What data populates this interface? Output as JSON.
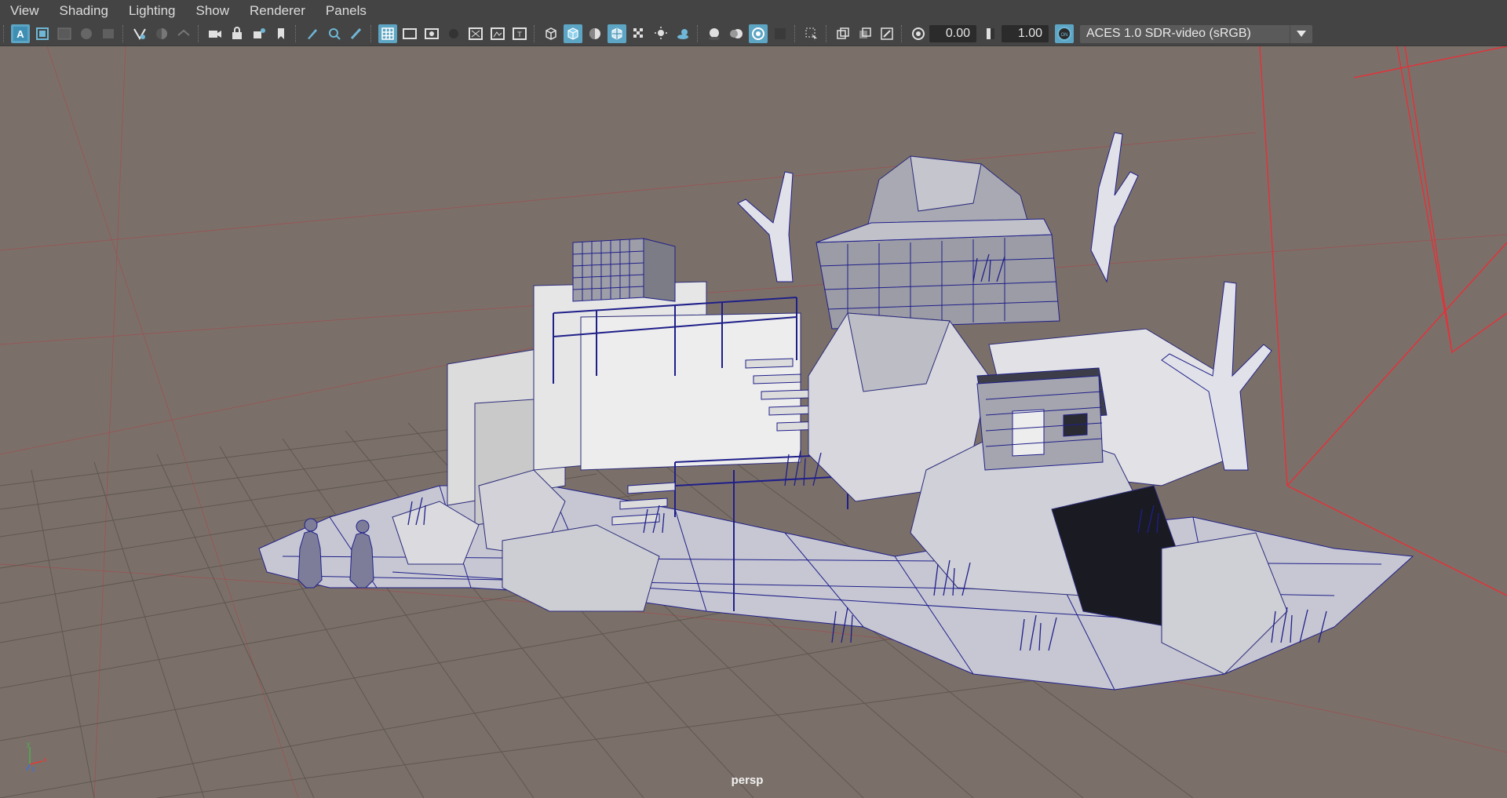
{
  "menubar": {
    "items": [
      "View",
      "Shading",
      "Lighting",
      "Show",
      "Renderer",
      "Panels"
    ]
  },
  "toolbar": {
    "exposure_value": "0.00",
    "gamma_value": "1.00",
    "color_management": "ACES 1.0 SDR-video (sRGB)",
    "accent_color": "#5da5c4",
    "icons": [
      "select-camera-icon",
      "camera-attributes-icon",
      "bookmark-icon",
      "image-plane-icon",
      "grid-icon",
      "film-gate-icon",
      "resolution-gate-icon",
      "gate-mask-icon",
      "field-chart-icon",
      "safe-action-icon",
      "safe-title-icon",
      "wireframe-icon",
      "smooth-shade-all-icon",
      "use-default-material-icon",
      "wireframe-on-shaded-icon",
      "xray-icon",
      "default-lighting-icon",
      "shadows-icon",
      "ambient-occlusion-icon",
      "isolate-select-icon",
      "exposure-icon",
      "gamma-icon",
      "color-management-toggle-icon"
    ]
  },
  "viewport": {
    "camera_label": "persp",
    "axis": {
      "y": "y",
      "x": "x",
      "z": "z"
    },
    "background_color": "#7b7069",
    "wire_color": "#1f1f8a"
  }
}
